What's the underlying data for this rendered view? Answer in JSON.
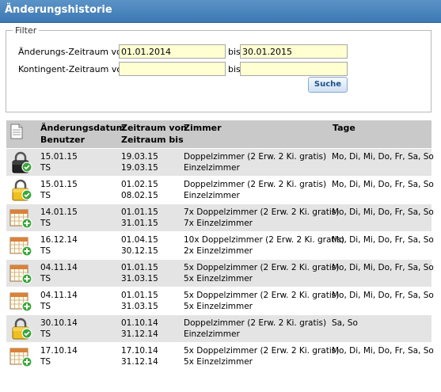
{
  "window": {
    "title": "Änderungshistorie"
  },
  "filter": {
    "legend": "Filter",
    "change_period_label": "Änderungs-Zeitraum von:",
    "change_from": "01.01.2014",
    "bis1": "bis",
    "change_to": "30.01.2015",
    "quota_period_label": "Kontingent-Zeitraum von:",
    "quota_from": "",
    "bis2": "bis",
    "quota_to": "",
    "search_button": "Suche"
  },
  "table": {
    "headers": {
      "change_date": "Änderungsdatum",
      "user": "Benutzer",
      "period_from": "Zeitraum von",
      "period_to": "Zeitraum bis",
      "rooms": "Zimmer",
      "days": "Tage"
    },
    "rows": [
      {
        "icon": "lock-check-icon",
        "date": "15.01.15",
        "user": "TS",
        "from": "19.03.15",
        "to": "19.03.15",
        "room1": "Doppelzimmer (2 Erw. 2 Ki. gratis)",
        "room2": "Einzelzimmer",
        "days": "Mo, Di, Mi, Do, Fr, Sa, So"
      },
      {
        "icon": "lock-check-icon",
        "date": "15.01.15",
        "user": "TS",
        "from": "01.02.15",
        "to": "08.02.15",
        "room1": "Doppelzimmer (2 Erw. 2 Ki. gratis)",
        "room2": "Einzelzimmer",
        "days": "Mo, Di, Mi, Do, Fr, Sa, So"
      },
      {
        "icon": "calendar-add-icon",
        "date": "14.01.15",
        "user": "TS",
        "from": "01.01.15",
        "to": "31.01.15",
        "room1": "7x Doppelzimmer (2 Erw. 2 Ki. gratis)",
        "room2": "7x Einzelzimmer",
        "days": "Mo, Di, Mi, Do, Fr, Sa, So"
      },
      {
        "icon": "calendar-add-icon",
        "date": "16.12.14",
        "user": "TS",
        "from": "01.04.15",
        "to": "30.12.15",
        "room1": "10x Doppelzimmer (2 Erw. 2 Ki. gratis)",
        "room2": "2x Einzelzimmer",
        "days": "Mo, Di, Mi, Do, Fr, Sa, So"
      },
      {
        "icon": "calendar-add-icon",
        "date": "04.11.14",
        "user": "TS",
        "from": "01.01.15",
        "to": "31.03.15",
        "room1": "5x Doppelzimmer (2 Erw. 2 Ki. gratis)",
        "room2": "5x Einzelzimmer",
        "days": "Mo, Di, Mi, Do, Fr, Sa, So"
      },
      {
        "icon": "calendar-add-icon",
        "date": "04.11.14",
        "user": "TS",
        "from": "01.01.15",
        "to": "31.03.15",
        "room1": "5x Doppelzimmer (2 Erw. 2 Ki. gratis)",
        "room2": "5x Einzelzimmer",
        "days": "Mo, Di, Mi, Do, Fr, Sa, So"
      },
      {
        "icon": "lock-check-icon",
        "date": "30.10.14",
        "user": "TS",
        "from": "01.10.14",
        "to": "31.12.14",
        "room1": "Doppelzimmer (2 Erw. 2 Ki. gratis)",
        "room2": "Einzelzimmer",
        "days": "Sa, So"
      },
      {
        "icon": "calendar-add-icon",
        "date": "17.10.14",
        "user": "TS",
        "from": "17.10.14",
        "to": "31.12.14",
        "room1": "5x Doppelzimmer (2 Erw. 2 Ki. gratis)",
        "room2": "5x Einzelzimmer",
        "days": "Mo, Di, Mi, Do, Fr, Sa, So"
      }
    ]
  },
  "colors": {
    "title_bar": "#4a86be",
    "header_bg": "#c9c9c9",
    "row_alt": "#e4e4e4",
    "input_bg": "#ffffd2",
    "button_text": "#1b4f8a"
  }
}
